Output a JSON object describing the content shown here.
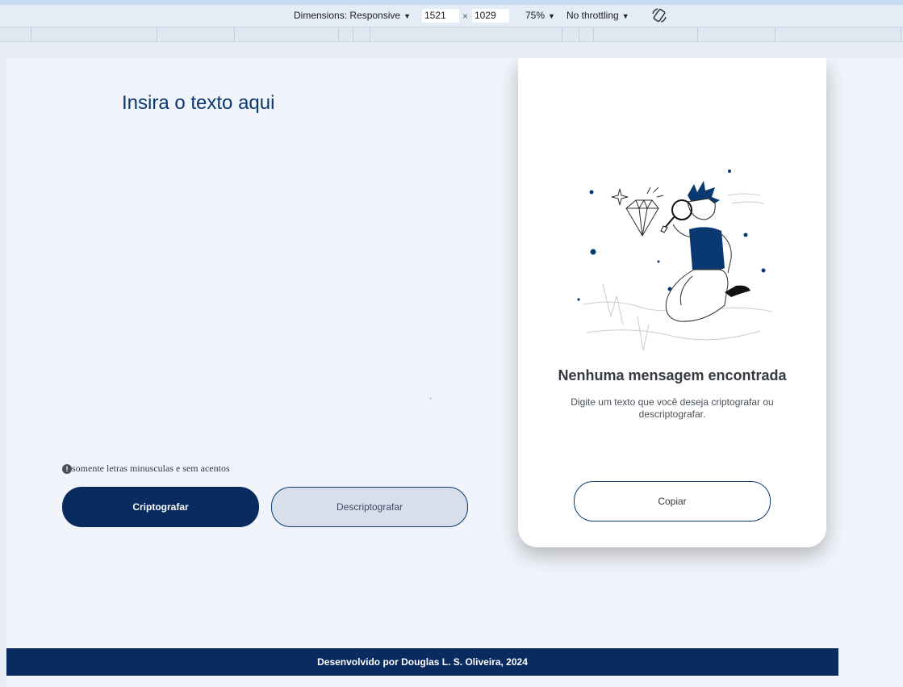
{
  "devtools": {
    "dimensions_label": "Dimensions: Responsive",
    "width_value": "1521",
    "times": "×",
    "height_value": "1029",
    "zoom_label": "75%",
    "throttling_label": "No throttling",
    "dropdown_arrow": "▼"
  },
  "main": {
    "title": "Insira o texto aqui",
    "hint_icon": "!",
    "hint_text": "somente letras minusculas e sem acentos",
    "encrypt_label": "Criptografar",
    "decrypt_label": "Descriptografar"
  },
  "output": {
    "title": "Nenhuma mensagem encontrada",
    "description": "Digite um texto que você deseja criptografar ou descriptografar.",
    "copy_label": "Copiar"
  },
  "footer": {
    "text": "Desenvolvido por Douglas L. S. Oliveira, 2024"
  },
  "colors": {
    "primary": "#0a2b5f",
    "title": "#0a3871",
    "background": "#f1f4fb",
    "secondary_button": "#d8dfea"
  },
  "icons": [
    "rotate-icon",
    "exclamation-icon",
    "search-illustration"
  ]
}
